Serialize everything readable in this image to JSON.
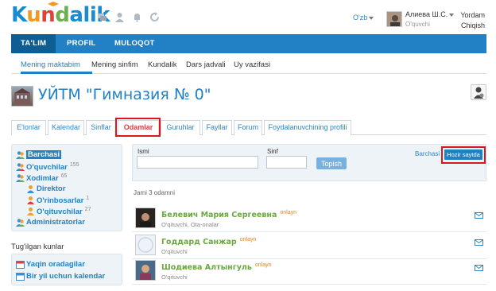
{
  "header": {
    "logo": {
      "p1": "K",
      "p2": "u",
      "p3": "n",
      "p4": "d",
      "p5": "alik"
    },
    "language": "O'zb",
    "user_name": "Алиева Ш.С.",
    "user_role": "O'quvchi",
    "help_link": "Yordam",
    "logout_link": "Chiqish"
  },
  "main_nav": [
    "TA'LIM",
    "PROFIL",
    "MULOQOT"
  ],
  "sub_nav": [
    "Mening maktabim",
    "Mening sinfim",
    "Kundalik",
    "Dars jadvali",
    "Uy vazifasi"
  ],
  "school_title": "УЙТМ \"Гимназия № 0\"",
  "tabs": [
    "E'lonlar",
    "Kalendar",
    "Sinflar",
    "Odamlar",
    "Guruhlar",
    "Fayllar",
    "Forum",
    "Foydalanuvchining profili"
  ],
  "sidebar": {
    "tree": [
      {
        "label": "Barchasi",
        "count": ""
      },
      {
        "label": "O'quvchilar",
        "count": "155"
      },
      {
        "label": "Xodimlar",
        "count": "65"
      },
      {
        "label": "Direktor",
        "count": ""
      },
      {
        "label": "O'rinbosarlar",
        "count": "1"
      },
      {
        "label": "O'qituvchilar",
        "count": "27"
      },
      {
        "label": "Administratorlar",
        "count": ""
      }
    ],
    "birthdays_title": "Tug'ilgan kunlar",
    "birthday_links": [
      "Yaqin oradagilar",
      "Bir yil uchun kalendar"
    ]
  },
  "search": {
    "name_label": "Ismi",
    "class_label": "Sinf",
    "name_value": "",
    "class_value": "",
    "find_button": "Topish",
    "all_link": "Barchasi",
    "online_button": "Hozir saytda"
  },
  "total_text": "Jami 3 odamni",
  "people": [
    {
      "name": "Белевич Мария Сергеевна",
      "status": "onlayn",
      "role": "O'qituvchi, Ota-onalar"
    },
    {
      "name": "Годдард Санжар",
      "status": "onlayn",
      "role": "O'qituvchi"
    },
    {
      "name": "Шодиева Алтынгуль",
      "status": "onlayn",
      "role": "O'qituvchi"
    }
  ],
  "colors": {
    "brand_blue": "#2181c4",
    "highlight_red": "#e0141c",
    "name_green": "#6aa840",
    "online_orange": "#e0861c"
  }
}
